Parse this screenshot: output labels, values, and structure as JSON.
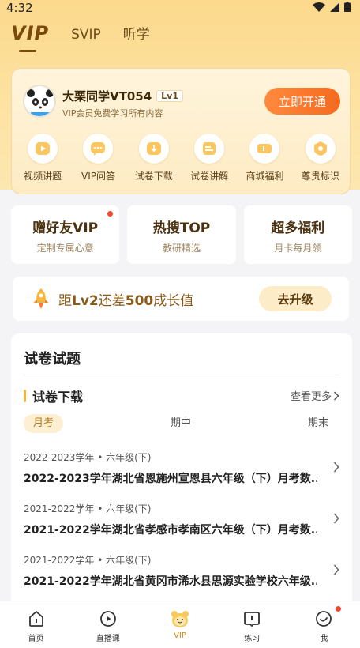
{
  "status": {
    "time": "4:32"
  },
  "top_tabs": [
    "VIP",
    "SVIP",
    "听学"
  ],
  "user": {
    "name": "大栗同学VT054",
    "level": "Lv1",
    "subtitle": "VIP会员免费学习所有内容",
    "open_button": "立即开通"
  },
  "perks": [
    {
      "label": "视频讲题",
      "icon": "video-play-icon"
    },
    {
      "label": "VIP问答",
      "icon": "chat-bubble-icon"
    },
    {
      "label": "试卷下载",
      "icon": "download-icon"
    },
    {
      "label": "试卷讲解",
      "icon": "paper-explain-icon"
    },
    {
      "label": "商城福利",
      "icon": "coupon-icon"
    },
    {
      "label": "尊贵标识",
      "icon": "badge-icon"
    }
  ],
  "promos": [
    {
      "title": "赠好友VIP",
      "subtitle": "定制专属心意",
      "badge_dot": true
    },
    {
      "title": "热搜TOP",
      "subtitle": "教研精选",
      "badge_dot": false
    },
    {
      "title": "超多福利",
      "subtitle": "月卡每月领",
      "badge_dot": false
    }
  ],
  "level_card": {
    "text_prefix": "距",
    "text_level": "Lv2",
    "text_mid": "还差",
    "text_points": "500",
    "text_suffix": "成长值",
    "button": "去升级"
  },
  "papers": {
    "section_title": "试卷试题",
    "subsection_title": "试卷下载",
    "more_label": "查看更多",
    "segments": [
      "月考",
      "期中",
      "期末"
    ],
    "active_segment": "月考",
    "items": [
      {
        "meta": "2022-2023学年 • 六年级(下)",
        "title": "2022-2023学年湖北省恩施州宣恩县六年级（下）月考数..."
      },
      {
        "meta": "2021-2022学年 • 六年级(下)",
        "title": "2021-2022学年湖北省孝感市孝南区六年级（下）月考数..."
      },
      {
        "meta": "2021-2022学年 • 六年级(下)",
        "title": "2021-2022学年湖北省黄冈市浠水县思源实验学校六年级..."
      }
    ]
  },
  "bottom_nav": [
    {
      "label": "首页",
      "icon": "home-icon"
    },
    {
      "label": "直播课",
      "icon": "live-class-icon"
    },
    {
      "label": "VIP",
      "icon": "vip-mascot-icon",
      "active": true
    },
    {
      "label": "练习",
      "icon": "practice-icon"
    },
    {
      "label": "我",
      "icon": "profile-icon",
      "badge_dot": true
    }
  ],
  "colors": {
    "accent_orange": "#f46a1f",
    "brand_gold": "#7a4a0c",
    "header_bg": "#fcd98c"
  }
}
